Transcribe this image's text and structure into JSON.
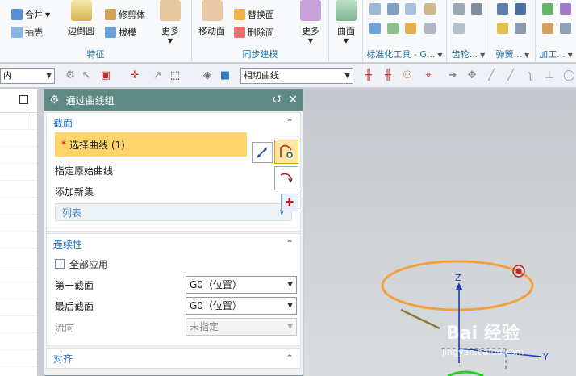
{
  "ribbon": {
    "groups": [
      {
        "label": "特征",
        "items": [
          "合并",
          "抽壳"
        ]
      },
      {
        "label": "同步建模",
        "items": [
          "移动面",
          "替换面",
          "删除面",
          "更多"
        ]
      },
      {
        "label": "标准化工具 - G...",
        "items": []
      },
      {
        "label": "齿轮...",
        "items": []
      },
      {
        "label": "弹簧...",
        "items": []
      },
      {
        "label": "加工...",
        "items": []
      }
    ],
    "edge_blend_label": "边倒圆",
    "trim_body_label": "修剪体",
    "draft_label": "拔模",
    "more_label": "更多",
    "more2_label": "更多",
    "surface_label": "曲面"
  },
  "toolbar": {
    "filter_value": "内",
    "snap_value": "相切曲线"
  },
  "dialog": {
    "title": "通过曲线组",
    "section_cross": {
      "title": "截面",
      "select_curve_label": "选择曲线 (1)",
      "specify_origin_label": "指定原始曲线",
      "add_new_set_label": "添加新集",
      "list_label": "列表"
    },
    "section_continuity": {
      "title": "连续性",
      "apply_all_label": "全部应用",
      "first_section_label": "第一截面",
      "first_section_value": "G0（位置）",
      "last_section_label": "最后截面",
      "last_section_value": "G0（位置）",
      "flow_label": "流向",
      "flow_value": "未指定"
    },
    "section_align": {
      "title": "对齐"
    }
  },
  "viewport": {
    "axis_z": "Z",
    "axis_y": "Y",
    "watermark": "Bai 经验",
    "watermark_url": "jingyan.baidu.com"
  },
  "colors": {
    "dialog_title_bg": "#5d8a82",
    "selection_highlight": "#ffd56b",
    "curve_orange": "#f0a040",
    "accent_blue": "#1f6fbf"
  }
}
